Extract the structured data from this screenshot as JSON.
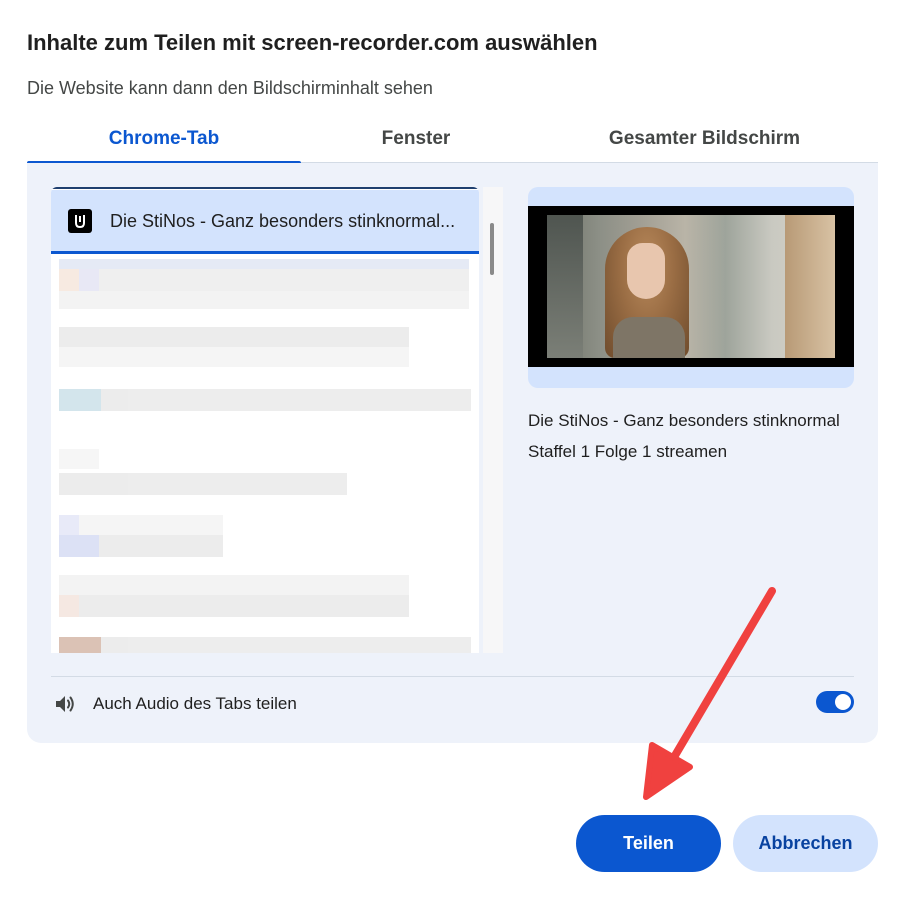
{
  "dialog": {
    "title": "Inhalte zum Teilen mit screen-recorder.com auswählen",
    "subtitle": "Die Website kann dann den Bildschirminhalt sehen"
  },
  "tabs": [
    {
      "label": "Chrome-Tab",
      "active": true
    },
    {
      "label": "Fenster",
      "active": false
    },
    {
      "label": "Gesamter Bildschirm",
      "active": false
    }
  ],
  "tab_list": {
    "selected_item": {
      "label": "Die StiNos - Ganz besonders stinknormal...",
      "icon": "site-favicon-icon"
    }
  },
  "preview": {
    "title": "Die StiNos - Ganz besonders stinknormal Staffel 1 Folge 1 streamen"
  },
  "audio": {
    "label": "Auch Audio des Tabs teilen",
    "icon": "speaker-icon",
    "enabled": true
  },
  "buttons": {
    "share": "Teilen",
    "cancel": "Abbrechen"
  },
  "colors": {
    "accent": "#0b57d0",
    "selected_bg": "#d3e3fd",
    "panel_bg": "#eef2fa",
    "annotation_arrow": "#f0413f"
  }
}
